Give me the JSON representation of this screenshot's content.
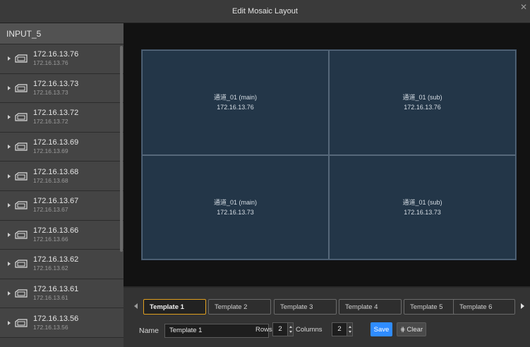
{
  "window": {
    "title": "Edit Mosaic Layout"
  },
  "sidebar": {
    "header": "INPUT_5",
    "devices": [
      {
        "ip": "172.16.13.76",
        "sub": "172.16.13.76"
      },
      {
        "ip": "172.16.13.73",
        "sub": "172.16.13.73"
      },
      {
        "ip": "172.16.13.72",
        "sub": "172.16.13.72"
      },
      {
        "ip": "172.16.13.69",
        "sub": "172.16.13.69"
      },
      {
        "ip": "172.16.13.68",
        "sub": "172.16.13.68"
      },
      {
        "ip": "172.16.13.67",
        "sub": "172.16.13.67"
      },
      {
        "ip": "172.16.13.66",
        "sub": "172.16.13.66"
      },
      {
        "ip": "172.16.13.62",
        "sub": "172.16.13.62"
      },
      {
        "ip": "172.16.13.61",
        "sub": "172.16.13.61"
      },
      {
        "ip": "172.16.13.56",
        "sub": "172.16.13.56"
      }
    ]
  },
  "mosaic": {
    "cells": [
      {
        "name": "通道_01 (main)",
        "ip": "172.16.13.76"
      },
      {
        "name": "通道_01 (sub)",
        "ip": "172.16.13.76"
      },
      {
        "name": "通道_01 (main)",
        "ip": "172.16.13.73"
      },
      {
        "name": "通道_01 (sub)",
        "ip": "172.16.13.73"
      }
    ]
  },
  "templates": {
    "tabs": [
      "Template 1",
      "Template 2",
      "Template 3",
      "Template 4",
      "Template 5",
      "Template 6"
    ],
    "active_index": 0
  },
  "form": {
    "name_label": "Name",
    "name_value": "Template 1",
    "rows_label": "Rows",
    "rows_value": "2",
    "columns_label": "Columns",
    "columns_value": "2",
    "save_label": "Save",
    "clear_label": "Clear",
    "clear_icon_glyph": "⋕"
  },
  "colors": {
    "mosaic_bg": "#233648",
    "active_tab_border": "#e0a020",
    "save_button": "#2f8cff"
  }
}
